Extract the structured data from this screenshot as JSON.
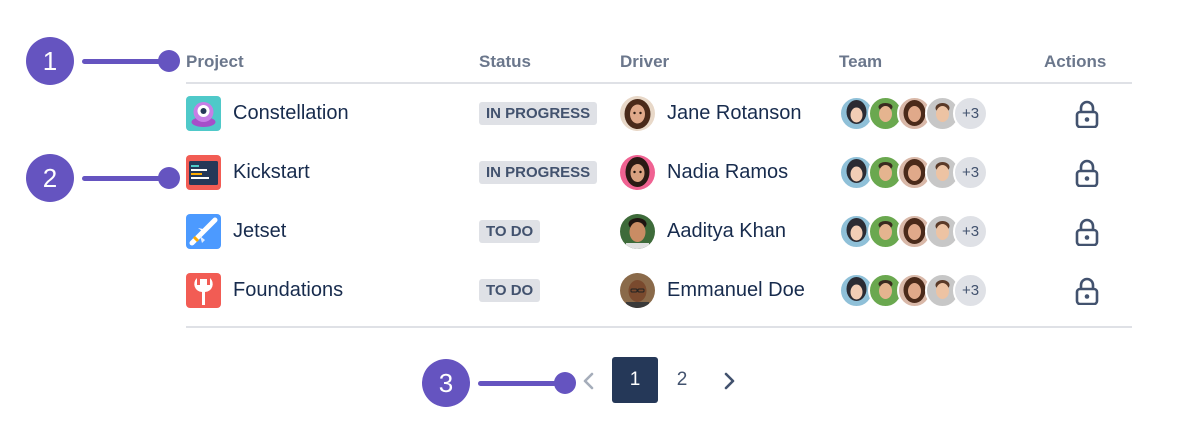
{
  "callouts": [
    "1",
    "2",
    "3"
  ],
  "table": {
    "headers": {
      "project": "Project",
      "status": "Status",
      "driver": "Driver",
      "team": "Team",
      "actions": "Actions"
    },
    "rows": [
      {
        "project": "Constellation",
        "project_icon": "alien-robot-icon",
        "status": "In progress",
        "driver": "Jane Rotanson",
        "team_more": "+3",
        "action_icon": "lock-icon"
      },
      {
        "project": "Kickstart",
        "project_icon": "code-window-icon",
        "status": "In progress",
        "driver": "Nadia Ramos",
        "team_more": "+3",
        "action_icon": "lock-icon"
      },
      {
        "project": "Jetset",
        "project_icon": "airplane-icon",
        "status": "To do",
        "driver": "Aaditya Khan",
        "team_more": "+3",
        "action_icon": "lock-icon"
      },
      {
        "project": "Foundations",
        "project_icon": "wrench-icon",
        "status": "To do",
        "driver": "Emmanuel Doe",
        "team_more": "+3",
        "action_icon": "lock-icon"
      }
    ]
  },
  "pagination": {
    "pages": [
      "1",
      "2"
    ],
    "current": "1"
  },
  "colors": {
    "callout": "#6554c0",
    "active_page": "#253858",
    "lozenge_bg": "#dfe1e6",
    "header_text": "#6b778c",
    "text": "#172b4d"
  }
}
